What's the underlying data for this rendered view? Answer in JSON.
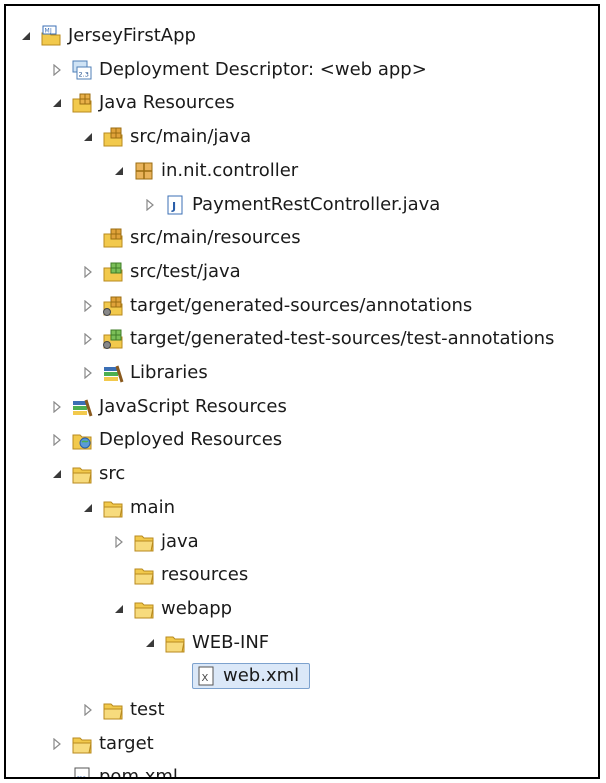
{
  "project_tree": {
    "items": [
      {
        "label": "JerseyFirstApp",
        "icon": "web-project-icon",
        "expander": "expanded",
        "depth": 0
      },
      {
        "label": "Deployment Descriptor: <web app>",
        "icon": "deployment-descriptor-icon",
        "expander": "collapsed",
        "depth": 1
      },
      {
        "label": "Java Resources",
        "icon": "java-resources-icon",
        "expander": "expanded",
        "depth": 1
      },
      {
        "label": "src/main/java",
        "icon": "source-folder-icon",
        "expander": "expanded",
        "depth": 2
      },
      {
        "label": "in.nit.controller",
        "icon": "package-icon",
        "expander": "expanded",
        "depth": 3
      },
      {
        "label": "PaymentRestController.java",
        "icon": "java-file-icon",
        "expander": "collapsed",
        "depth": 4
      },
      {
        "label": "src/main/resources",
        "icon": "source-folder-icon",
        "expander": "none",
        "depth": 2
      },
      {
        "label": "src/test/java",
        "icon": "test-source-folder-icon",
        "expander": "collapsed",
        "depth": 2
      },
      {
        "label": "target/generated-sources/annotations",
        "icon": "generated-source-folder-icon",
        "expander": "collapsed",
        "depth": 2
      },
      {
        "label": "target/generated-test-sources/test-annotations",
        "icon": "generated-test-source-folder-icon",
        "expander": "collapsed",
        "depth": 2
      },
      {
        "label": "Libraries",
        "icon": "libraries-icon",
        "expander": "collapsed",
        "depth": 2
      },
      {
        "label": "JavaScript Resources",
        "icon": "libraries-icon",
        "expander": "collapsed",
        "depth": 1
      },
      {
        "label": "Deployed Resources",
        "icon": "deployed-resources-icon",
        "expander": "collapsed",
        "depth": 1
      },
      {
        "label": "src",
        "icon": "folder-icon",
        "expander": "expanded",
        "depth": 1
      },
      {
        "label": "main",
        "icon": "folder-icon",
        "expander": "expanded",
        "depth": 2
      },
      {
        "label": "java",
        "icon": "folder-icon",
        "expander": "collapsed",
        "depth": 3
      },
      {
        "label": "resources",
        "icon": "folder-icon",
        "expander": "none",
        "depth": 3
      },
      {
        "label": "webapp",
        "icon": "folder-icon",
        "expander": "expanded",
        "depth": 3
      },
      {
        "label": "WEB-INF",
        "icon": "folder-icon",
        "expander": "expanded",
        "depth": 4
      },
      {
        "label": "web.xml",
        "icon": "xml-file-icon",
        "expander": "none",
        "depth": 5,
        "selected": true
      },
      {
        "label": "test",
        "icon": "folder-icon",
        "expander": "collapsed",
        "depth": 2
      },
      {
        "label": "target",
        "icon": "folder-icon",
        "expander": "collapsed",
        "depth": 1
      },
      {
        "label": "pom.xml",
        "icon": "maven-pom-icon",
        "expander": "none",
        "depth": 1
      }
    ]
  },
  "colors": {
    "selection_fill": "#dbe8f8",
    "selection_border": "#7da2ce",
    "folder": "#f2c94c",
    "package_jar": "#d9a441",
    "text": "#1a1a1a"
  }
}
